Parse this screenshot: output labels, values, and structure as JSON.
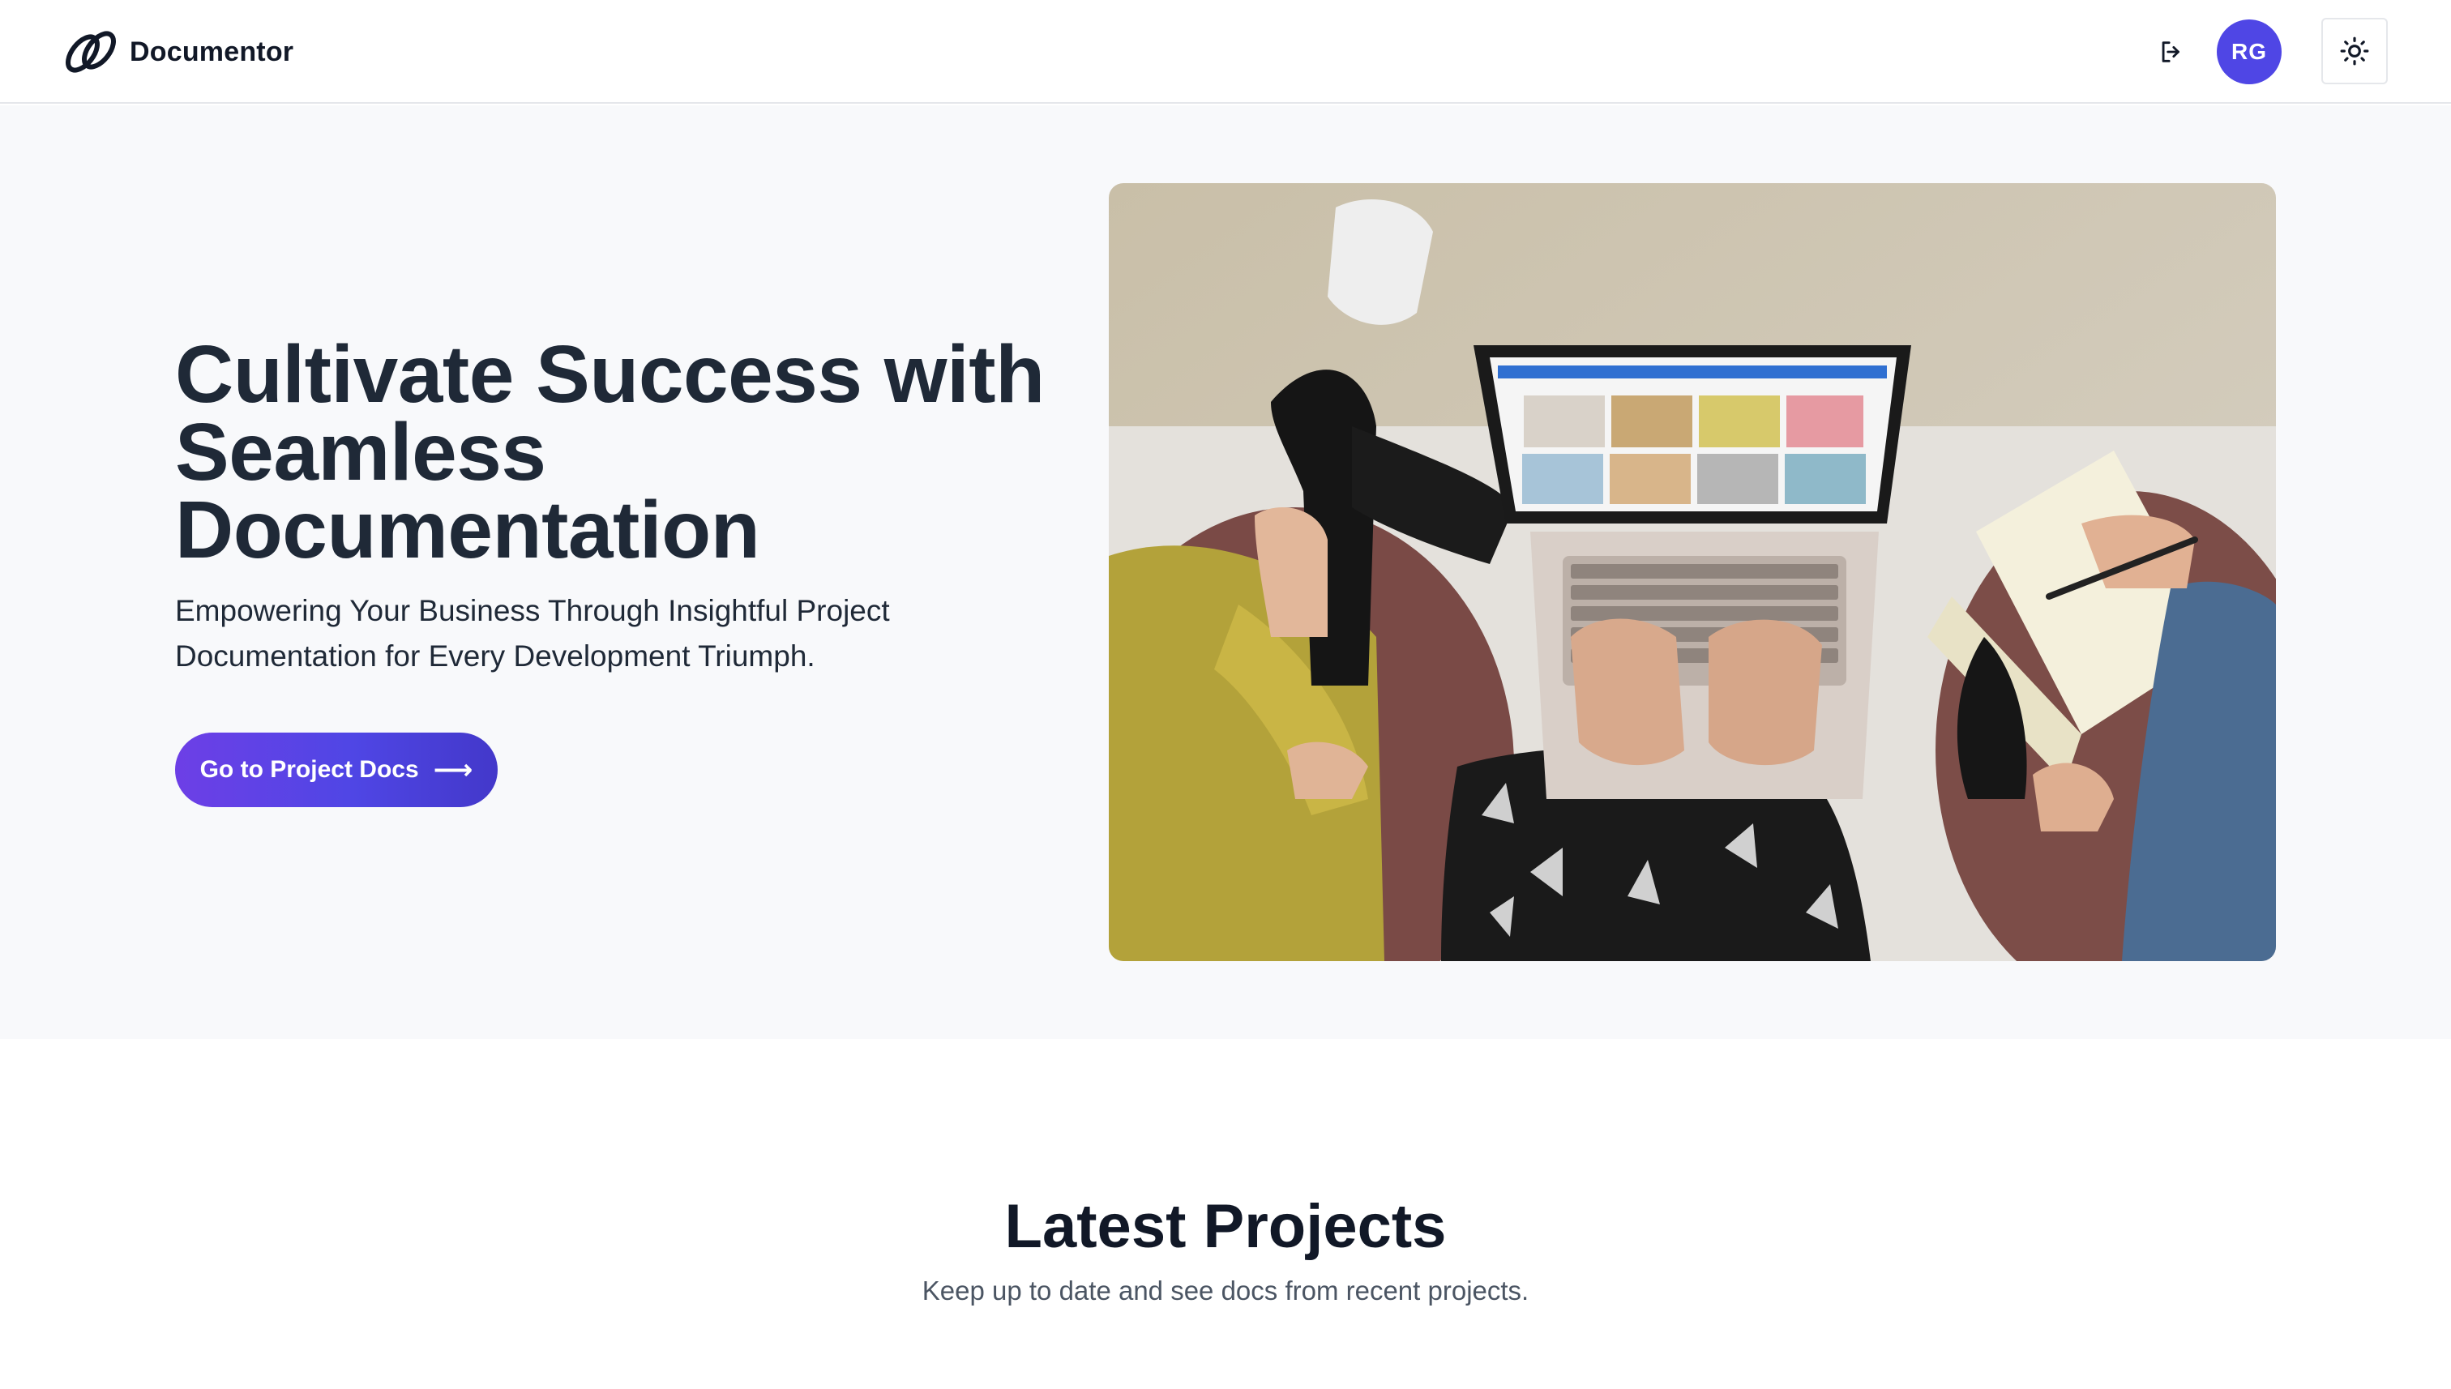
{
  "header": {
    "brand_name": "Documentor",
    "logo_icon": "interlocked-rings-logo-icon",
    "logout_icon": "logout-icon",
    "avatar_initials": "RG",
    "theme_toggle_icon": "sun-icon"
  },
  "hero": {
    "title": "Cultivate Success with Seamless Documentation",
    "subtitle": "Empowering Your Business Through Insightful Project Documentation for Every Development Triumph.",
    "cta_label": "Go to Project Docs",
    "cta_arrow": "⟶",
    "image_icon": "team-laptop-photo"
  },
  "latest_projects": {
    "title": "Latest Projects",
    "subtitle": "Keep up to date and see docs from recent projects."
  },
  "colors": {
    "accent": "#4f46e5",
    "cta_gradient_start": "#6d3fe6",
    "hero_bg": "#f8f9fb",
    "text_dark": "#1f2937"
  }
}
